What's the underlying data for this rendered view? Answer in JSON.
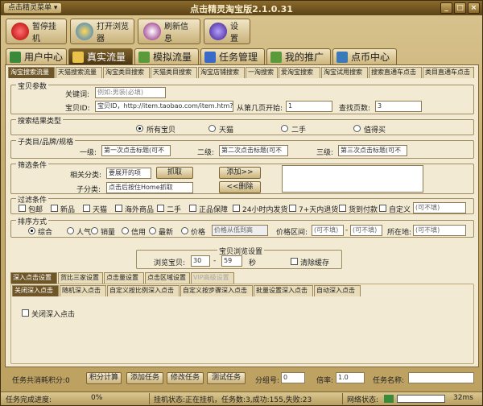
{
  "title_menu": "点击精灵菜单 ▾",
  "title": "点击精灵淘宝版2.1.0.31",
  "window_buttons": [
    "_",
    "□",
    "×"
  ],
  "toolbar": [
    "暂停挂机",
    "打开浏览器",
    "刷新信息",
    "设置"
  ],
  "main_tabs": [
    "用户中心",
    "真实流量",
    "模拟流量",
    "任务管理",
    "我的推广",
    "点币中心"
  ],
  "sub_tabs": [
    "淘宝搜索流量",
    "天猫搜索流量",
    "淘宝类目搜索",
    "天猫类目搜索",
    "淘宝店铺搜索",
    "一淘搜索",
    "爱淘宝搜索",
    "淘宝试用搜索",
    "搜索直通车点击",
    "类目直通车点击"
  ],
  "baby": {
    "group": "宝贝参数",
    "kw_label": "关键词:",
    "kw_placeholder": "例如:男装(必填)",
    "id_label": "宝贝ID:",
    "id_value": "宝贝ID，http://item.taobao.com/item.htm?id=11",
    "page_label": "从第几页开始:",
    "page_value": "1",
    "find_label": "查找页数:",
    "find_value": "3"
  },
  "search_type": {
    "group": "搜索结果类型",
    "options": [
      "所有宝贝",
      "天猫",
      "二手",
      "值得买"
    ],
    "selected": 0
  },
  "category": {
    "group": "子类目/品牌/规格",
    "l1": "一级:",
    "l1v": "第一次点击标题(可不",
    "l2": "二级:",
    "l2v": "第二次点击标题(可不",
    "l3": "三级:",
    "l3v": "第三次点击标题(可不"
  },
  "filter": {
    "group": "筛选条件",
    "rel_label": "相关分类:",
    "rel_value": "要展开的项",
    "get": "抓取",
    "sub_label": "子分类:",
    "sub_value": "点击后按住Home抓取",
    "add": "添加>>",
    "del": "<<删除"
  },
  "filter_cond": {
    "group": "过滤条件",
    "items": [
      "包邮",
      "新品",
      "天猫",
      "海外商品",
      "二手",
      "正品保障",
      "24小时内发货",
      "7+天内退货",
      "货到付款",
      "自定义"
    ],
    "custom_placeholder": "(可不填)"
  },
  "sort": {
    "group": "排序方式",
    "options": [
      "综合",
      "人气",
      "销量",
      "信用",
      "最新",
      "价格"
    ],
    "selected": 0,
    "price_select": "价格从低到高",
    "range_label": "价格区间:",
    "range_from": "(可不填)",
    "range_to": "(可不填)",
    "loc_label": "所在地:",
    "loc_value": "(可不填)"
  },
  "browse": {
    "group": "宝贝浏览设置",
    "label": "浏览宝贝:",
    "from": "30",
    "to": "59",
    "unit": "秒",
    "clear_cache": "清除缓存"
  },
  "deep_tabs": [
    "深入点击设置",
    "货比三家设置",
    "点击量设置",
    "点击区域设置",
    "VIP高级设置"
  ],
  "deep_sub_tabs": [
    "关闭深入点击",
    "随机深入点击",
    "自定义按比例深入点击",
    "自定义按步骤深入点击",
    "批量设置深入点击",
    "自动深入点击"
  ],
  "close_deep": "关闭深入点击",
  "bottom": {
    "points_label": "任务共消耗积分:0",
    "calc": "积分计算",
    "add": "添加任务",
    "edit": "修改任务",
    "test": "测试任务",
    "group_label": "分组号:",
    "group_value": "0",
    "rate_label": "倍率:",
    "rate_value": "1.0",
    "task_name_label": "任务名称:"
  },
  "status": {
    "progress_label": "任务完成进度:",
    "progress_value": "0%",
    "machine": "挂机状态:正在挂机，任务数:3,成功:155,失败:23",
    "net_label": "网络状态:",
    "latency": "32ms"
  }
}
